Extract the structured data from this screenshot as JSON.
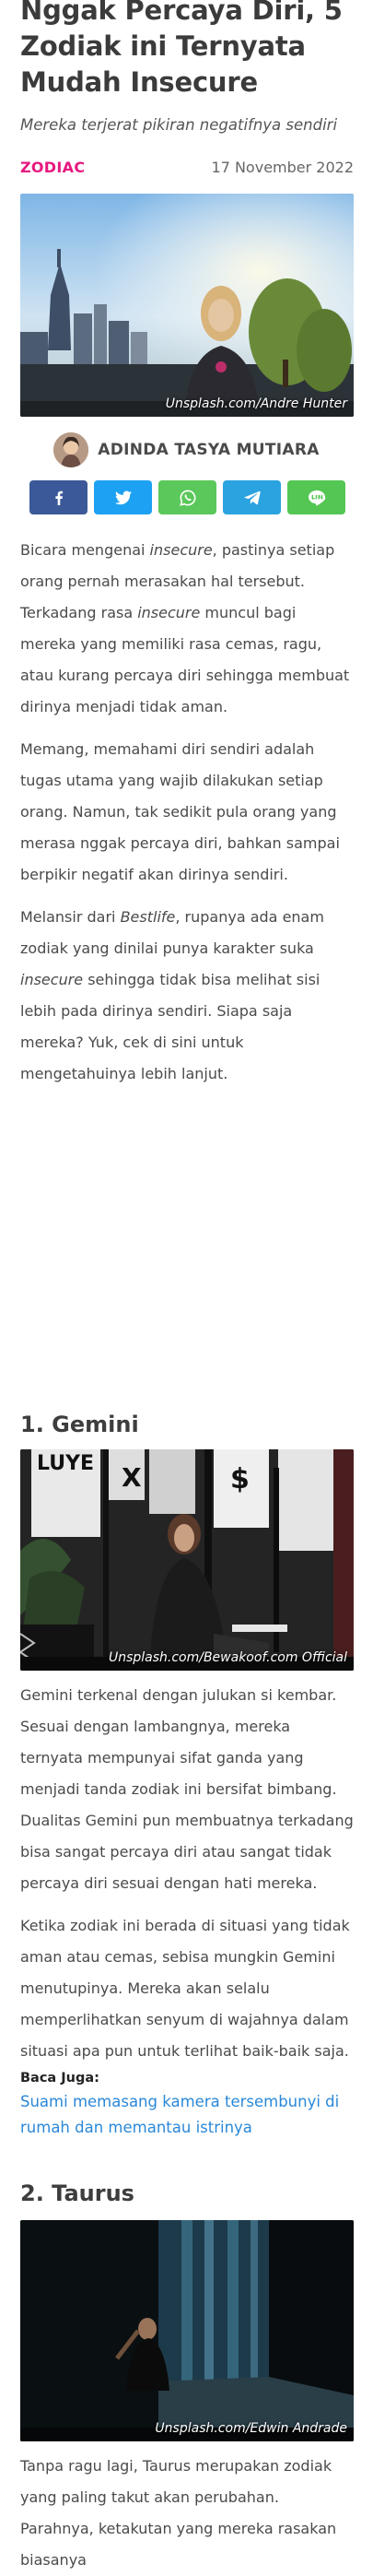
{
  "article": {
    "title": "Nggak Percaya Diri, 5 Zodiak ini Ternyata Mudah Insecure",
    "subtitle": "Mereka terjerat pikiran negatifnya sendiri",
    "category": "ZODIAC",
    "date": "17 November 2022",
    "hero_credit": "Unsplash.com/Andre Hunter",
    "author": "ADINDA TASYA MUTIARA"
  },
  "share": [
    {
      "name": "facebook",
      "icon": "facebook-icon",
      "color": "#3b5998"
    },
    {
      "name": "twitter",
      "icon": "twitter-icon",
      "color": "#1da1f2"
    },
    {
      "name": "whatsapp",
      "icon": "whatsapp-icon",
      "color": "#5ac85a"
    },
    {
      "name": "telegram",
      "icon": "telegram-icon",
      "color": "#2aa3e0"
    },
    {
      "name": "line",
      "icon": "line-icon",
      "color": "#54c654"
    }
  ],
  "intro": {
    "p1": [
      {
        "t": "Bicara mengenai "
      },
      {
        "t": "insecure",
        "i": true
      },
      {
        "t": ", pastinya setiap orang pernah merasakan hal tersebut. Terkadang rasa "
      },
      {
        "t": "insecure",
        "i": true
      },
      {
        "t": " muncul bagi mereka yang memiliki rasa cemas, ragu, atau kurang percaya diri sehingga membuat dirinya menjadi tidak aman."
      }
    ],
    "p2": [
      {
        "t": "Memang, memahami diri sendiri adalah tugas utama yang wajib dilakukan setiap orang. Namun, tak sedikit pula orang yang merasa nggak percaya diri, bahkan sampai berpikir negatif akan dirinya sendiri."
      }
    ],
    "p3": [
      {
        "t": "Melansir dari "
      },
      {
        "t": "Bestlife",
        "i": true
      },
      {
        "t": ", rupanya ada enam zodiak yang dinilai punya karakter suka "
      },
      {
        "t": "insecure",
        "i": true
      },
      {
        "t": " sehingga tidak bisa melihat sisi lebih pada dirinya sendiri. Siapa saja mereka? Yuk, cek di sini untuk mengetahuinya lebih lanjut."
      }
    ]
  },
  "section1": {
    "heading": "1. Gemini",
    "image_credit": "Unsplash.com/Bewakoof.com Official",
    "p1": [
      {
        "t": "Gemini terkenal dengan julukan si kembar. Sesuai dengan lambangnya, mereka ternyata mempunyai sifat ganda yang menjadi tanda zodiak ini bersifat bimbang. Dualitas Gemini pun membuatnya terkadang bisa sangat percaya diri atau sangat tidak percaya diri sesuai dengan hati mereka."
      }
    ],
    "p2": [
      {
        "t": "Ketika zodiak ini berada di situasi yang tidak aman atau cemas, sebisa mungkin Gemini menutupinya. Mereka akan selalu memperlihatkan senyum di wajahnya dalam situasi apa pun untuk terlihat baik-baik saja."
      }
    ],
    "baca_label": "Baca Juga:",
    "baca_link": "Suami memasang kamera tersembunyi di rumah dan memantau istrinya"
  },
  "section2": {
    "heading": "2. Taurus",
    "image_credit": "Unsplash.com/Edwin Andrade",
    "p1": [
      {
        "t": "Tanpa ragu lagi, Taurus merupakan zodiak yang paling takut akan perubahan. Parahnya, ketakutan yang mereka rasakan biasanya"
      }
    ]
  },
  "hero_text": "LUYE"
}
